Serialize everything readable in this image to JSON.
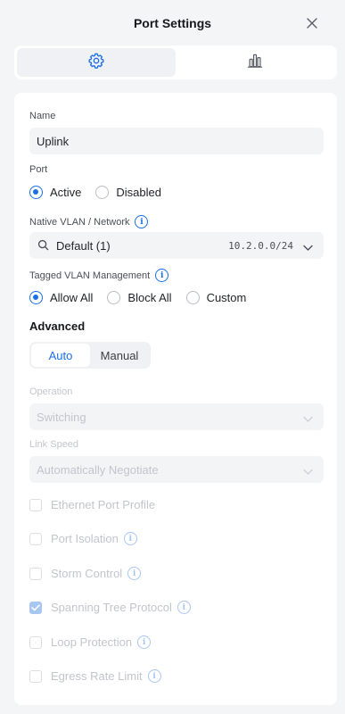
{
  "header": {
    "title": "Port Settings"
  },
  "tabs": [
    {
      "icon": "gear-icon"
    },
    {
      "icon": "bar-chart-icon"
    }
  ],
  "name": {
    "label": "Name",
    "value": "Uplink"
  },
  "port": {
    "label": "Port",
    "options": [
      {
        "label": "Active",
        "selected": true
      },
      {
        "label": "Disabled",
        "selected": false
      }
    ]
  },
  "native_vlan": {
    "label": "Native VLAN / Network",
    "value": "Default (1)",
    "subnet": "10.2.0.0/24"
  },
  "tagged_vlan": {
    "label": "Tagged VLAN Management",
    "options": [
      {
        "label": "Allow All",
        "selected": true
      },
      {
        "label": "Block All",
        "selected": false
      },
      {
        "label": "Custom",
        "selected": false
      }
    ]
  },
  "advanced": {
    "heading": "Advanced",
    "modes": [
      {
        "label": "Auto",
        "selected": true
      },
      {
        "label": "Manual",
        "selected": false
      }
    ]
  },
  "operation": {
    "label": "Operation",
    "value": "Switching"
  },
  "link_speed": {
    "label": "Link Speed",
    "value": "Automatically Negotiate"
  },
  "checkboxes": [
    {
      "label": "Ethernet Port Profile",
      "checked": false,
      "info": false
    },
    {
      "label": "Port Isolation",
      "checked": false,
      "info": true
    },
    {
      "label": "Storm Control",
      "checked": false,
      "info": true
    },
    {
      "label": "Spanning Tree Protocol",
      "checked": true,
      "info": true
    },
    {
      "label": "Loop Protection",
      "checked": false,
      "info": true
    },
    {
      "label": "Egress Rate Limit",
      "checked": false,
      "info": true
    }
  ],
  "colors": {
    "accent": "#1a6fe8",
    "disabled_text": "#c2c5cb",
    "background": "#f4f5f7"
  }
}
